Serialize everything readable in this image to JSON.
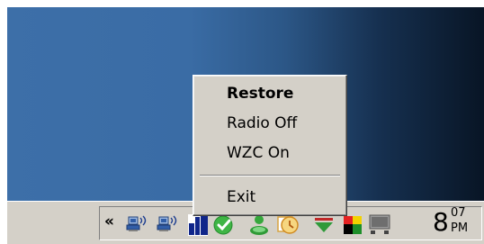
{
  "context_menu": {
    "items": [
      {
        "label": "Restore",
        "default": true
      },
      {
        "label": "Radio Off",
        "default": false
      },
      {
        "label": "WZC On",
        "default": false
      }
    ],
    "exit_label": "Exit"
  },
  "tray": {
    "chevron": "«",
    "icons": [
      {
        "name": "wireless-network-icon-1"
      },
      {
        "name": "wireless-network-icon-2"
      },
      {
        "name": "network-bars-icon"
      },
      {
        "name": "green-check-icon"
      },
      {
        "name": "green-person-icon"
      },
      {
        "name": "clock-app-icon"
      },
      {
        "name": "download-arrow-icon"
      },
      {
        "name": "color-flag-icon"
      },
      {
        "name": "monitor-icon"
      }
    ],
    "clock": {
      "hour": "8",
      "minutes": "07",
      "ampm": "PM"
    }
  },
  "colors": {
    "desktop_left": "#3d6fa8",
    "desktop_right": "#081525",
    "taskbar": "#d4d0c8",
    "menu_background": "#d4d0c8"
  }
}
